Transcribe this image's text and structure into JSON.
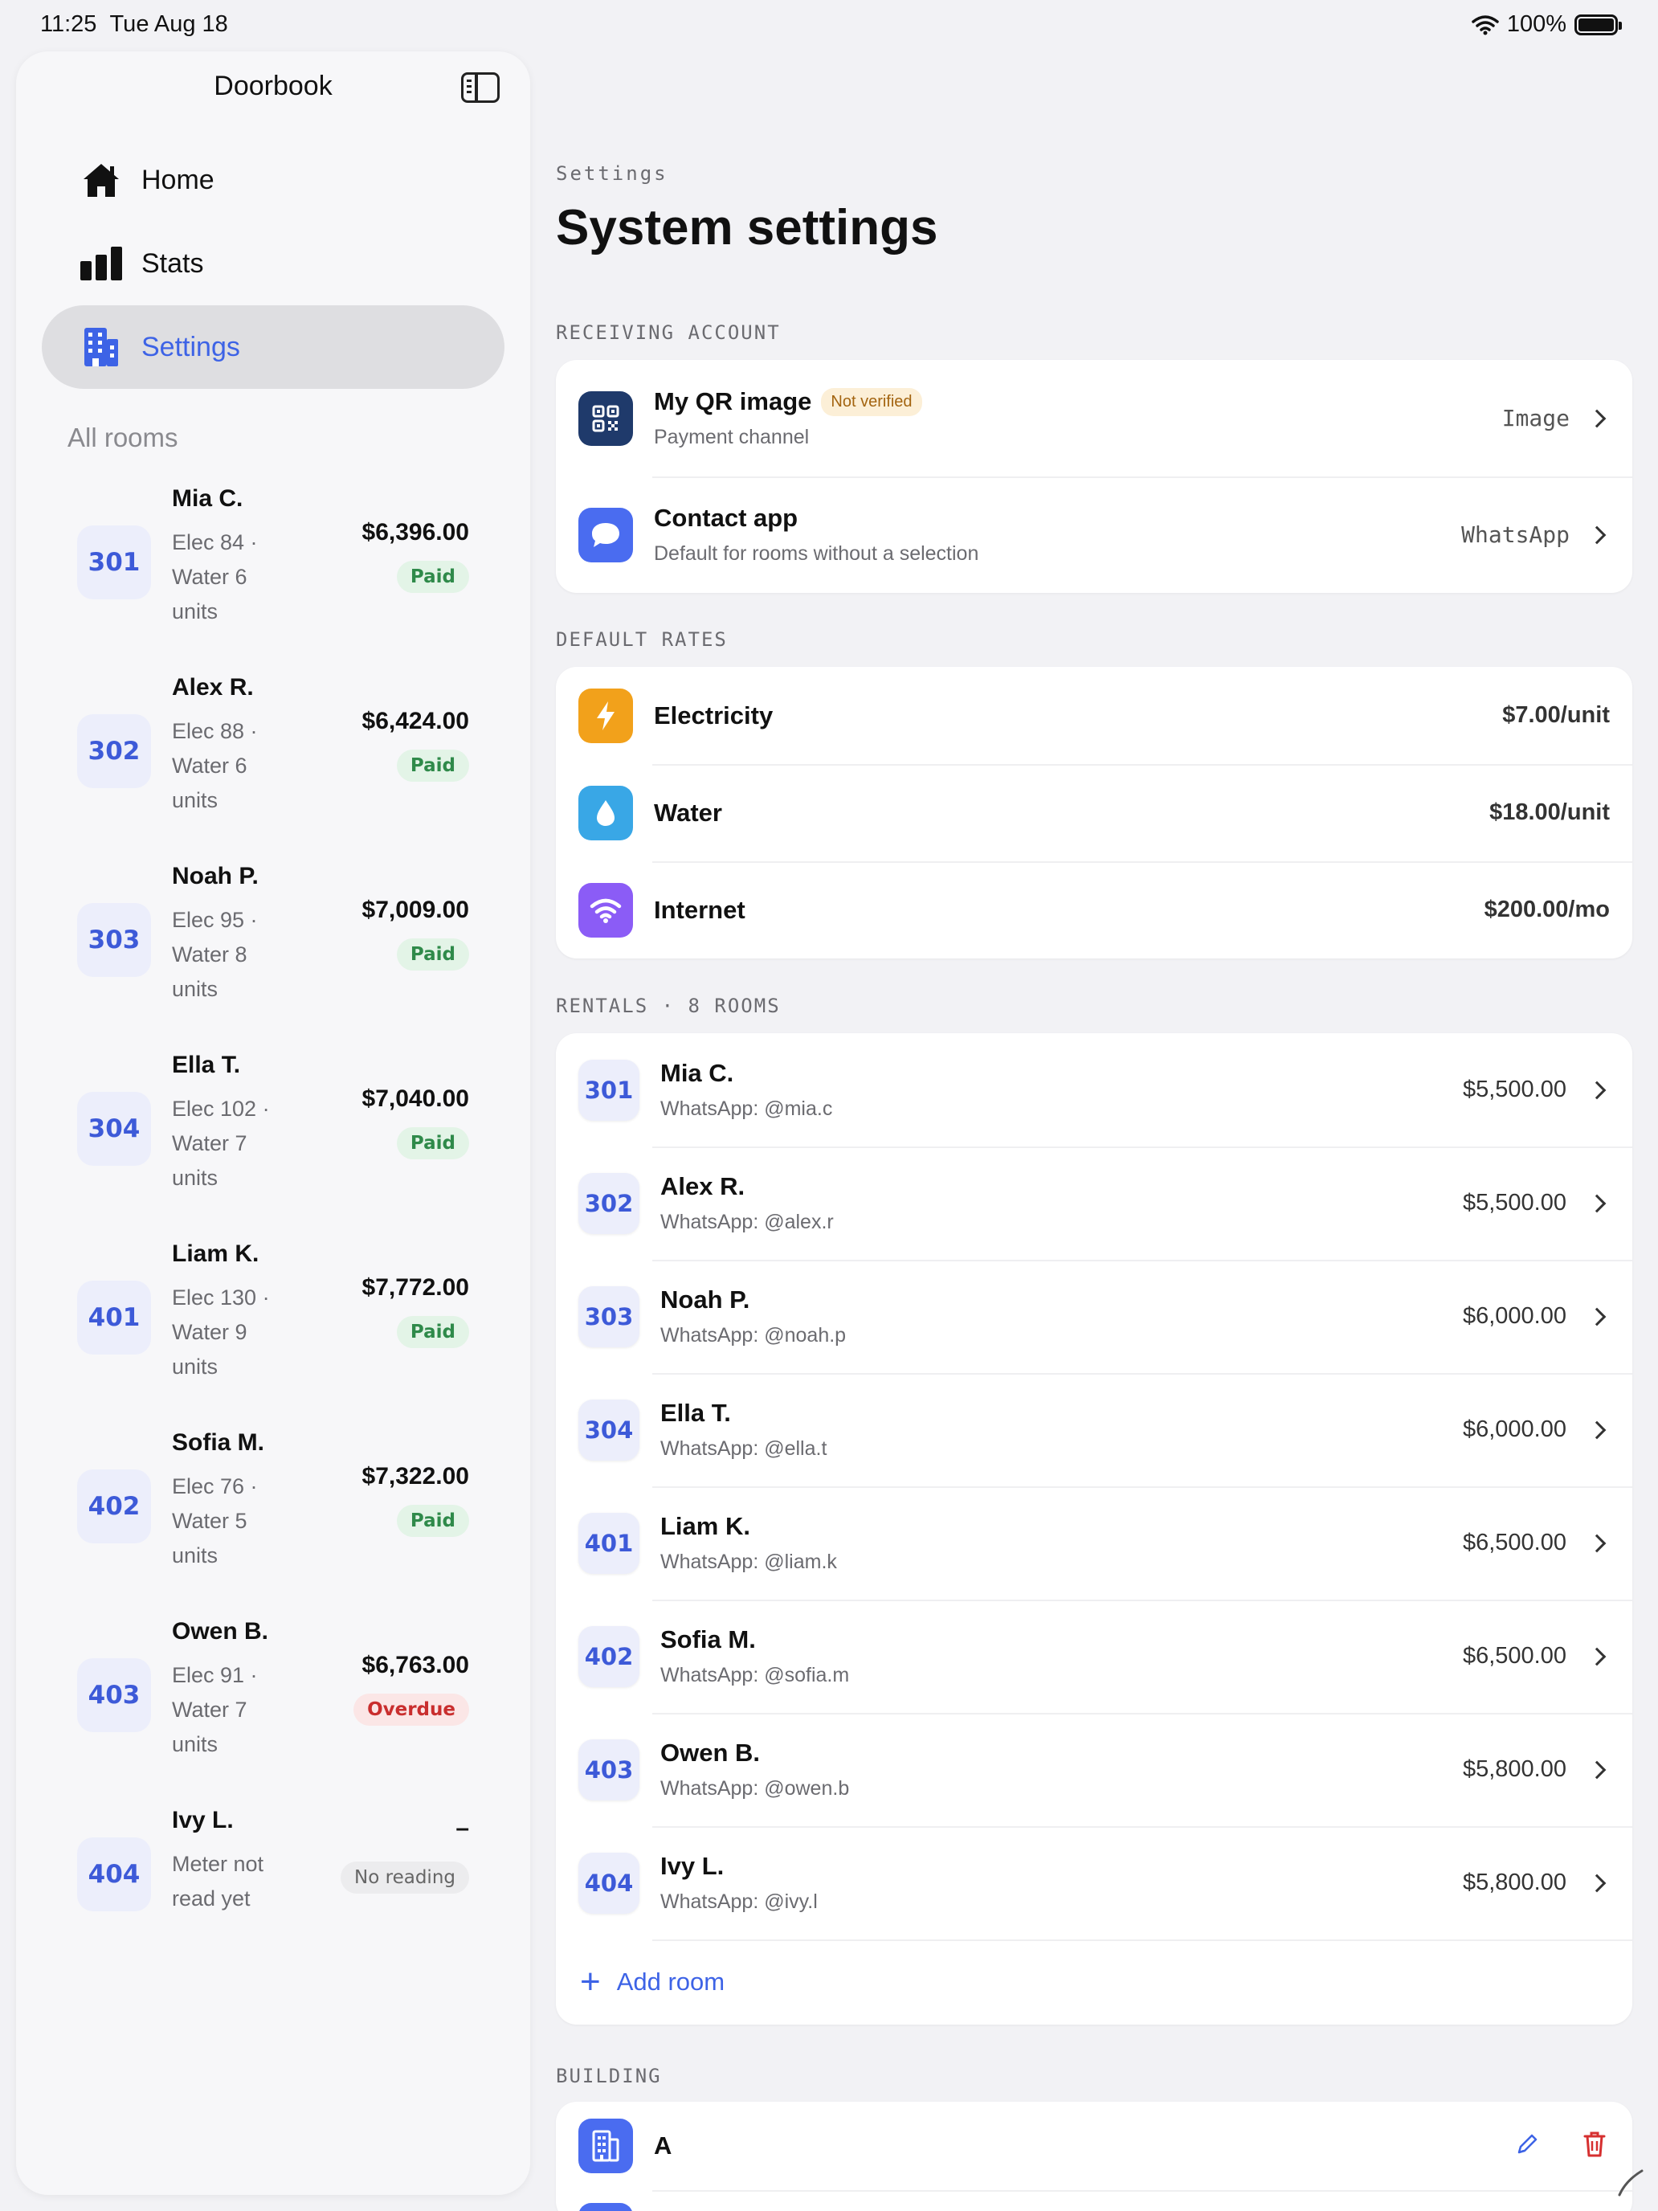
{
  "status_bar": {
    "time": "11:25",
    "date": "Tue Aug 18",
    "battery": "100%"
  },
  "sidebar": {
    "title": "Doorbook",
    "nav": [
      {
        "label": "Home",
        "icon": "house-icon"
      },
      {
        "label": "Stats",
        "icon": "bar-chart-icon"
      },
      {
        "label": "Settings",
        "icon": "building-icon",
        "active": true
      }
    ],
    "section_label": "All rooms",
    "rooms": [
      {
        "number": "301",
        "name": "Mia C.",
        "detail": "Elec 84 · Water 6 units",
        "amount": "$6,396.00",
        "status": "Paid",
        "status_type": "paid"
      },
      {
        "number": "302",
        "name": "Alex R.",
        "detail": "Elec 88 · Water 6 units",
        "amount": "$6,424.00",
        "status": "Paid",
        "status_type": "paid"
      },
      {
        "number": "303",
        "name": "Noah P.",
        "detail": "Elec 95 · Water 8 units",
        "amount": "$7,009.00",
        "status": "Paid",
        "status_type": "paid"
      },
      {
        "number": "304",
        "name": "Ella T.",
        "detail": "Elec 102 · Water 7 units",
        "amount": "$7,040.00",
        "status": "Paid",
        "status_type": "paid"
      },
      {
        "number": "401",
        "name": "Liam K.",
        "detail": "Elec 130 · Water 9 units",
        "amount": "$7,772.00",
        "status": "Paid",
        "status_type": "paid"
      },
      {
        "number": "402",
        "name": "Sofia M.",
        "detail": "Elec 76 · Water 5 units",
        "amount": "$7,322.00",
        "status": "Paid",
        "status_type": "paid"
      },
      {
        "number": "403",
        "name": "Owen B.",
        "detail": "Elec 91 · Water 7 units",
        "amount": "$6,763.00",
        "status": "Overdue",
        "status_type": "overdue"
      },
      {
        "number": "404",
        "name": "Ivy L.",
        "detail": "Meter not read yet",
        "amount": "–",
        "status": "No reading",
        "status_type": "none"
      }
    ]
  },
  "main": {
    "eyebrow": "Settings",
    "title": "System settings",
    "receiving": {
      "label": "RECEIVING ACCOUNT",
      "qr": {
        "title": "My QR image",
        "badge": "Not verified",
        "subtitle": "Payment channel",
        "value": "Image",
        "icon": "qr-code-icon",
        "color": "#1f3a6b"
      },
      "contact": {
        "title": "Contact app",
        "subtitle": "Default for rooms without a selection",
        "value": "WhatsApp",
        "icon": "chat-bubble-icon",
        "color": "#4a6cf0"
      }
    },
    "rates": {
      "label": "DEFAULT RATES",
      "items": [
        {
          "title": "Electricity",
          "value": "$7.00/unit",
          "icon": "lightning-icon",
          "color": "#f2a11b"
        },
        {
          "title": "Water",
          "value": "$18.00/unit",
          "icon": "water-drop-icon",
          "color": "#39a7e6"
        },
        {
          "title": "Internet",
          "value": "$200.00/mo",
          "icon": "wifi-icon",
          "color": "#8b5cf6"
        }
      ]
    },
    "rentals": {
      "label": "RENTALS · 8 ROOMS",
      "items": [
        {
          "number": "301",
          "name": "Mia C.",
          "contact": "WhatsApp: @mia.c",
          "rent": "$5,500.00"
        },
        {
          "number": "302",
          "name": "Alex R.",
          "contact": "WhatsApp: @alex.r",
          "rent": "$5,500.00"
        },
        {
          "number": "303",
          "name": "Noah P.",
          "contact": "WhatsApp: @noah.p",
          "rent": "$6,000.00"
        },
        {
          "number": "304",
          "name": "Ella T.",
          "contact": "WhatsApp: @ella.t",
          "rent": "$6,000.00"
        },
        {
          "number": "401",
          "name": "Liam K.",
          "contact": "WhatsApp: @liam.k",
          "rent": "$6,500.00"
        },
        {
          "number": "402",
          "name": "Sofia M.",
          "contact": "WhatsApp: @sofia.m",
          "rent": "$6,500.00"
        },
        {
          "number": "403",
          "name": "Owen B.",
          "contact": "WhatsApp: @owen.b",
          "rent": "$5,800.00"
        },
        {
          "number": "404",
          "name": "Ivy L.",
          "contact": "WhatsApp: @ivy.l",
          "rent": "$5,800.00"
        }
      ],
      "add_label": "Add room"
    },
    "building": {
      "label": "BUILDING",
      "items": [
        {
          "name": "A",
          "icon": "building-icon",
          "color": "#4a6cf0"
        }
      ]
    }
  }
}
